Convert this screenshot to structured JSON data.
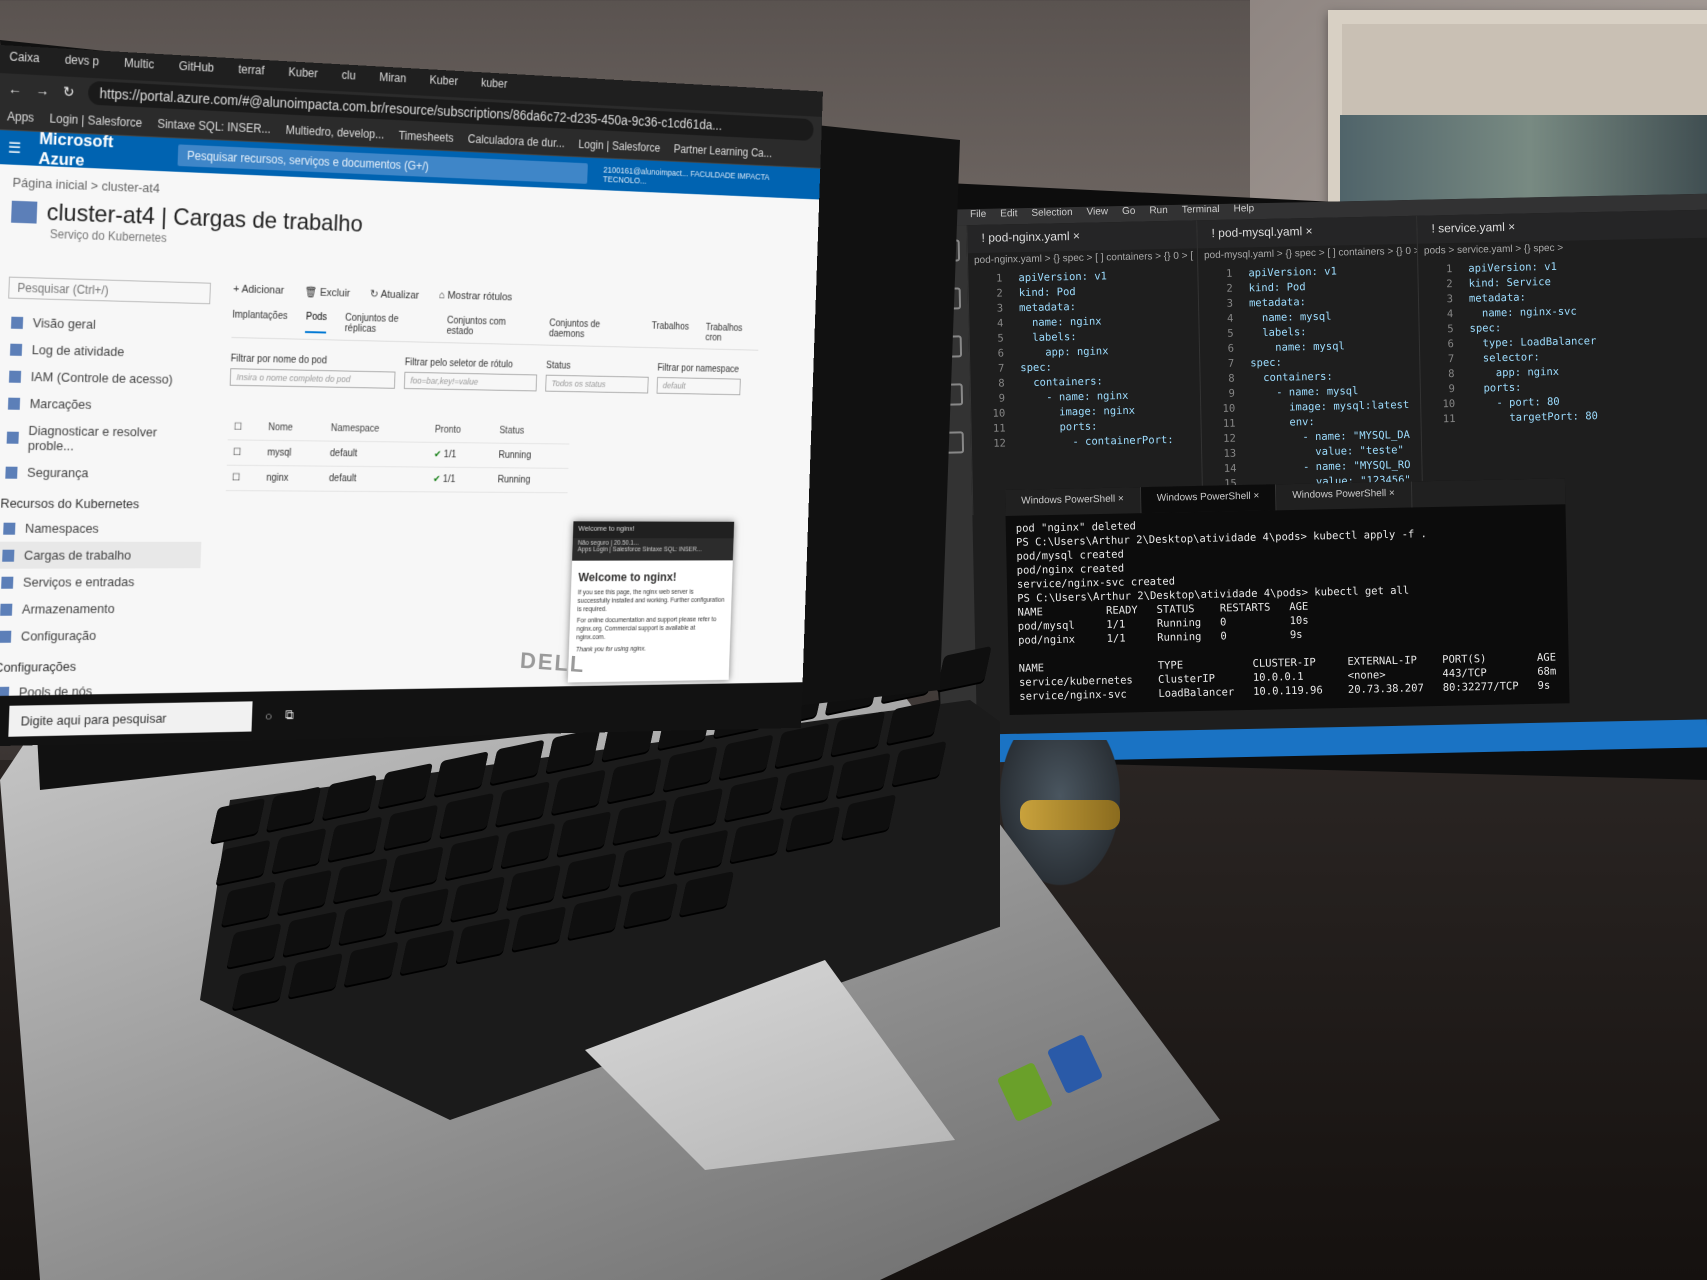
{
  "browser": {
    "tabs": [
      "Caixa",
      "devs p",
      "Multic",
      "GitHub",
      "terraf",
      "Kuber",
      "clu",
      "Miran",
      "Kuber",
      "kuber"
    ],
    "url": "https://portal.azure.com/#@alunoimpacta.com.br/resource/subscriptions/86da6c72-d235-450a-9c36-c1cd61da...",
    "bookmarks": [
      "Apps",
      "Login | Salesforce",
      "Sintaxe SQL: INSER...",
      "Multiedro, develop...",
      "Timesheets",
      "Calculadora de dur...",
      "Login | Salesforce",
      "Partner Learning Ca..."
    ]
  },
  "azure": {
    "brand": "Microsoft Azure",
    "search_placeholder": "Pesquisar recursos, serviços e documentos (G+/)",
    "account": "2100161@alunoimpact... FACULDADE IMPACTA TECNOLO...",
    "breadcrumb": "Página inicial > cluster-at4",
    "title": "cluster-at4 | Cargas de trabalho",
    "subtitle": "Serviço do Kubernetes",
    "sidebar": {
      "search": "Pesquisar (Ctrl+/)",
      "items": [
        "Visão geral",
        "Log de atividade",
        "IAM (Controle de acesso)",
        "Marcações",
        "Diagnosticar e resolver proble...",
        "Segurança"
      ],
      "section_k8s": "Recursos do Kubernetes",
      "k8s_items": [
        "Namespaces",
        "Cargas de trabalho",
        "Serviços e entradas",
        "Armazenamento",
        "Configuração"
      ],
      "section_config": "Configurações",
      "config_items": [
        "Pools de nós"
      ]
    },
    "toolbar": [
      "Adicionar",
      "Excluir",
      "Atualizar",
      "Mostrar rótulos"
    ],
    "tabs": [
      "Implantações",
      "Pods",
      "Conjuntos de réplicas",
      "Conjuntos com estado",
      "Conjuntos de daemons",
      "Trabalhos",
      "Trabalhos cron"
    ],
    "filters": {
      "pod_label": "Filtrar por nome do pod",
      "pod_placeholder": "Insira o nome completo do pod",
      "selector_label": "Filtrar pelo seletor de rótulo",
      "selector_placeholder": "foo=bar,key!=value",
      "status_label": "Status",
      "status_value": "Todos os status",
      "ns_label": "Filtrar por namespace",
      "ns_value": "default"
    },
    "table": {
      "headers": [
        "Nome",
        "Namespace",
        "Pronto",
        "Status"
      ],
      "rows": [
        [
          "mysql",
          "default",
          "1/1",
          "Running"
        ],
        [
          "nginx",
          "default",
          "1/1",
          "Running"
        ]
      ]
    }
  },
  "nginx_window": {
    "tab": "Welcome to nginx!",
    "address": "Não seguro | 20.50.1...",
    "bookmarks": "Apps  Login | Salesforce  Sintaxe SQL: INSER...",
    "heading": "Welcome to nginx!",
    "p1": "If you see this page, the nginx web server is successfully installed and working. Further configuration is required.",
    "p2": "For online documentation and support please refer to nginx.org. Commercial support is available at nginx.com.",
    "p3": "Thank you for using nginx."
  },
  "laptop_taskbar": {
    "search": "Digite aqui para pesquisar"
  },
  "laptop_brand": "DELL",
  "vscode": {
    "menu": [
      "File",
      "Edit",
      "Selection",
      "View",
      "Go",
      "Run",
      "Terminal",
      "Help"
    ],
    "panes": [
      {
        "tab": "pod-nginx.yaml",
        "crumbs": "pod-nginx.yaml > {} spec > [ ] containers > {} 0 > [",
        "lines": [
          "apiVersion: v1",
          "kind: Pod",
          "metadata:",
          "  name: nginx",
          "  labels:",
          "    app: nginx",
          "spec:",
          "  containers:",
          "    - name: nginx",
          "      image: nginx",
          "      ports:",
          "        - containerPort:"
        ]
      },
      {
        "tab": "pod-mysql.yaml",
        "crumbs": "pod-mysql.yaml > {} spec > [ ] containers > {} 0 > [",
        "lines": [
          "apiVersion: v1",
          "kind: Pod",
          "metadata:",
          "  name: mysql",
          "  labels:",
          "    name: mysql",
          "spec:",
          "  containers:",
          "    - name: mysql",
          "      image: mysql:latest",
          "      env:",
          "        - name: \"MYSQL_DA",
          "          value: \"teste\"",
          "        - name: \"MYSQL_RO",
          "          value: \"123456\""
        ]
      },
      {
        "tab": "service.yaml",
        "crumbs": "pods > service.yaml > {} spec >",
        "lines": [
          "apiVersion: v1",
          "kind: Service",
          "metadata:",
          "  name: nginx-svc",
          "spec:",
          "  type: LoadBalancer",
          "  selector:",
          "    app: nginx",
          "  ports:",
          "    - port: 80",
          "      targetPort: 80"
        ]
      }
    ]
  },
  "terminal": {
    "tabs": [
      "Windows PowerShell",
      "Windows PowerShell",
      "Windows PowerShell"
    ],
    "lines": [
      "pod \"nginx\" deleted",
      "PS C:\\Users\\Arthur 2\\Desktop\\atividade 4\\pods> kubectl apply -f .",
      "pod/mysql created",
      "pod/nginx created",
      "service/nginx-svc created",
      "PS C:\\Users\\Arthur 2\\Desktop\\atividade 4\\pods> kubectl get all",
      "NAME          READY   STATUS    RESTARTS   AGE",
      "pod/mysql     1/1     Running   0          10s",
      "pod/nginx     1/1     Running   0          9s",
      "",
      "NAME                  TYPE           CLUSTER-IP     EXTERNAL-IP    PORT(S)        AGE",
      "service/kubernetes    ClusterIP      10.0.0.1       <none>         443/TCP        68m",
      "service/nginx-svc     LoadBalancer   10.0.119.96    20.73.38.207   80:32277/TCP   9s"
    ]
  }
}
